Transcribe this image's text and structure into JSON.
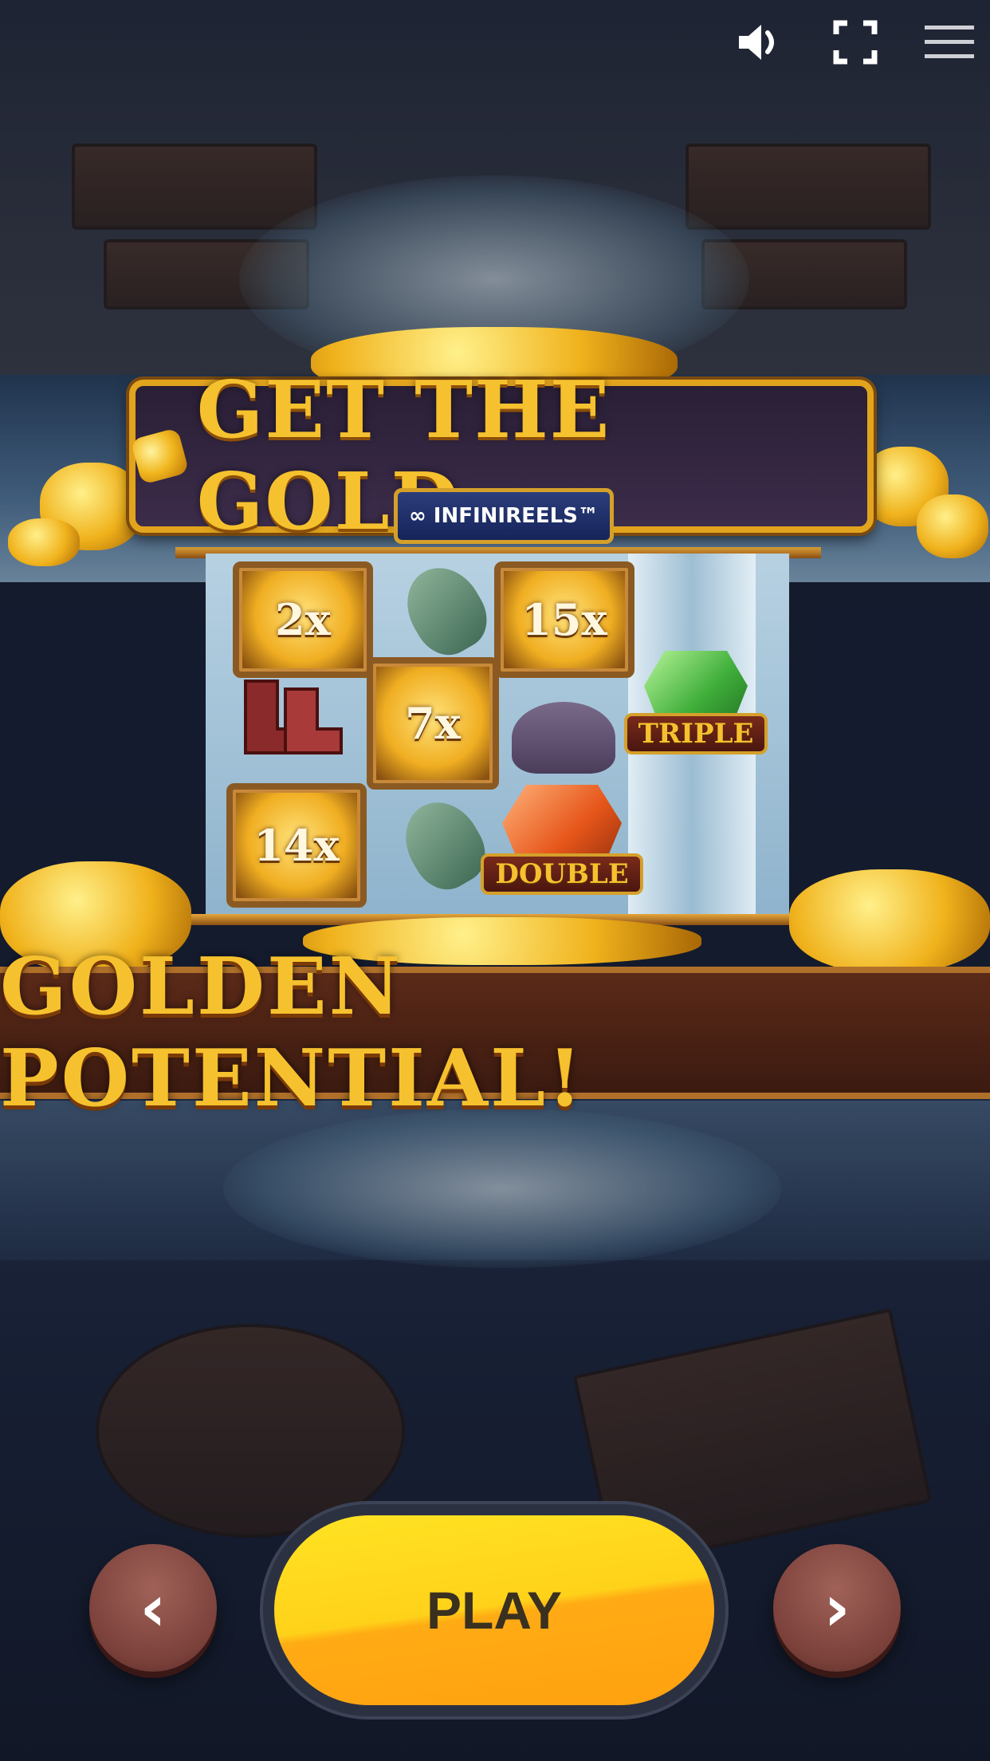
{
  "top_bar": {
    "sound_icon": "speaker-icon",
    "fullscreen_icon": "fullscreen-icon",
    "menu_icon": "hamburger-menu-icon"
  },
  "logo": {
    "title": "GET THE GOLD",
    "subtitle": "∞ INFINIREELS™"
  },
  "reels": {
    "multipliers": [
      "2x",
      "15x",
      "7x",
      "14x"
    ],
    "tags": [
      "TRIPLE",
      "DOUBLE"
    ]
  },
  "banner": {
    "text": "GOLDEN POTENTIAL!"
  },
  "controls": {
    "prev_label": "‹",
    "play_label": "PLAY",
    "next_label": "›"
  },
  "colors": {
    "gold": "#f6c12e",
    "play_button": "#ffd21a",
    "nav_button": "#7a403a"
  }
}
